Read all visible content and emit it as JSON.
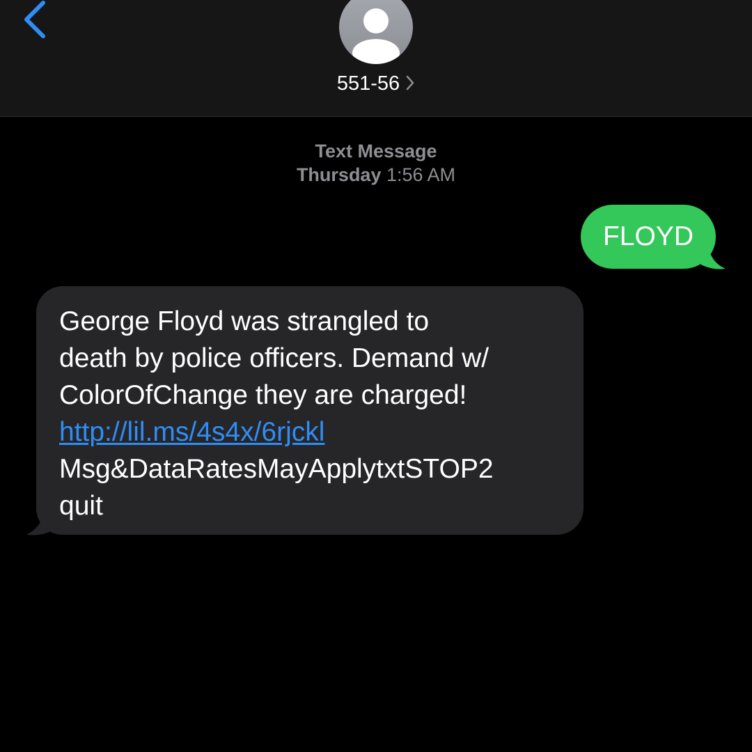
{
  "header": {
    "back_icon": "chevron-left-icon",
    "avatar_icon": "person-silhouette-icon",
    "contact_name": "551-56",
    "contact_chevron_icon": "chevron-right-icon"
  },
  "thread": {
    "message_type": "Text Message",
    "timestamp_day": "Thursday",
    "timestamp_time": "1:56 AM"
  },
  "messages": [
    {
      "direction": "outgoing",
      "text": "FLOYD"
    },
    {
      "direction": "incoming",
      "lines": [
        "George Floyd was strangled to",
        "death by police officers. Demand w/",
        "ColorOfChange they are charged!"
      ],
      "link": "http://lil.ms/4s4x/6rjckl",
      "footer_lines": [
        "Msg&DataRatesMayApplytxtSTOP2",
        "quit"
      ]
    }
  ],
  "colors": {
    "header_bg": "#161616",
    "background": "#000000",
    "outgoing_bubble": "#34c759",
    "incoming_bubble": "#262628",
    "accent_blue": "#2f8df5",
    "meta_gray": "#8e8e93"
  }
}
